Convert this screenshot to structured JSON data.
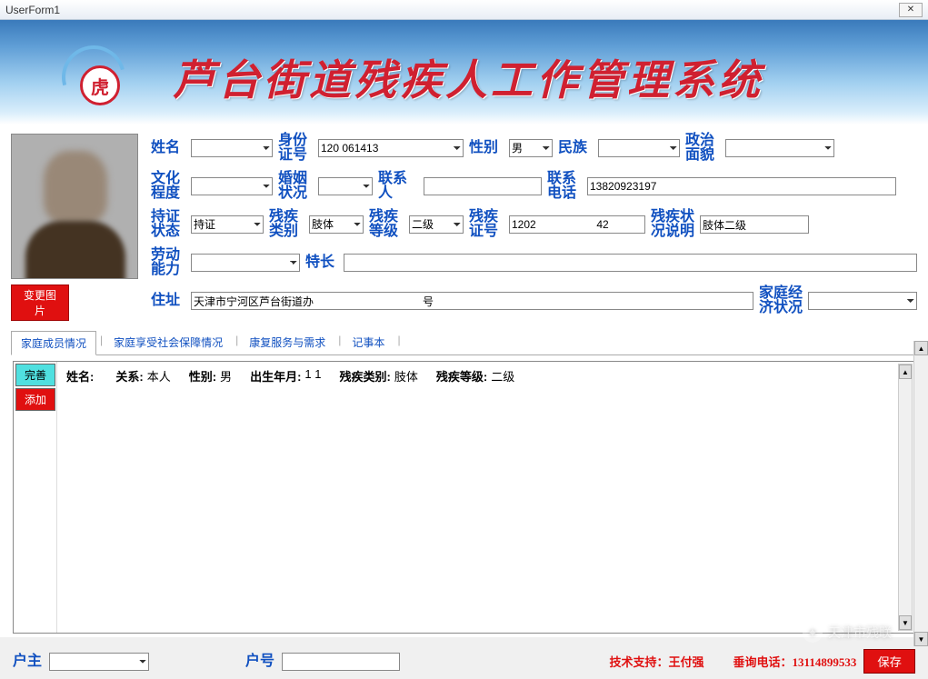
{
  "window": {
    "title": "UserForm1"
  },
  "banner": {
    "title": "芦台街道残疾人工作管理系统",
    "logo_char": "虎"
  },
  "photo": {
    "change_btn": "变更图片"
  },
  "labels": {
    "name": "姓名",
    "id_no": "身份\n证号",
    "gender": "性别",
    "ethnic": "民族",
    "political": "政治\n面貌",
    "edu": "文化\n程度",
    "marital": "婚姻\n状况",
    "contact_person": "联系人",
    "contact_phone": "联系\n电话",
    "cert_status": "持证\n状态",
    "disability_type": "残疾\n类别",
    "disability_level": "残疾\n等级",
    "disability_cert": "残疾\n证号",
    "disability_desc": "残疾状\n况说明",
    "labor": "劳动\n能力",
    "specialty": "特长",
    "address": "住址",
    "family_econ": "家庭经\n济状况",
    "householder": "户主",
    "household_no": "户号"
  },
  "fields": {
    "name": "",
    "id_no": "120          061413",
    "gender": "男",
    "ethnic": "",
    "political": "",
    "edu": "",
    "marital": "",
    "contact_person": "",
    "contact_phone": "13820923197",
    "cert_status": "持证",
    "disability_type": "肢体",
    "disability_level": "二级",
    "disability_cert": "1202                    42",
    "disability_desc": "肢体二级",
    "labor": "",
    "specialty": "",
    "address": "天津市宁河区芦台街道办                                    号",
    "family_econ": "",
    "householder": "",
    "household_no": ""
  },
  "tabs": {
    "items": [
      "家庭成员情况",
      "家庭享受社会保障情况",
      "康复服务与需求",
      "记事本"
    ],
    "active": 0
  },
  "side_buttons": {
    "complete": "完善",
    "add": "添加"
  },
  "member": {
    "labels": {
      "name": "姓名:",
      "relation": "关系:",
      "gender": "性别:",
      "birth": "出生年月:",
      "dtype": "残疾类别:",
      "dlevel": "残疾等级:"
    },
    "values": {
      "name": "",
      "relation": "本人",
      "gender": "男",
      "birth": "1        1",
      "dtype": "肢体",
      "dlevel": "二级"
    }
  },
  "footer": {
    "support": "技术支持：王付强",
    "hotline_label": "垂询电话：",
    "hotline_num": "13114899533",
    "save": "保存"
  },
  "watermark": "天津市残联"
}
